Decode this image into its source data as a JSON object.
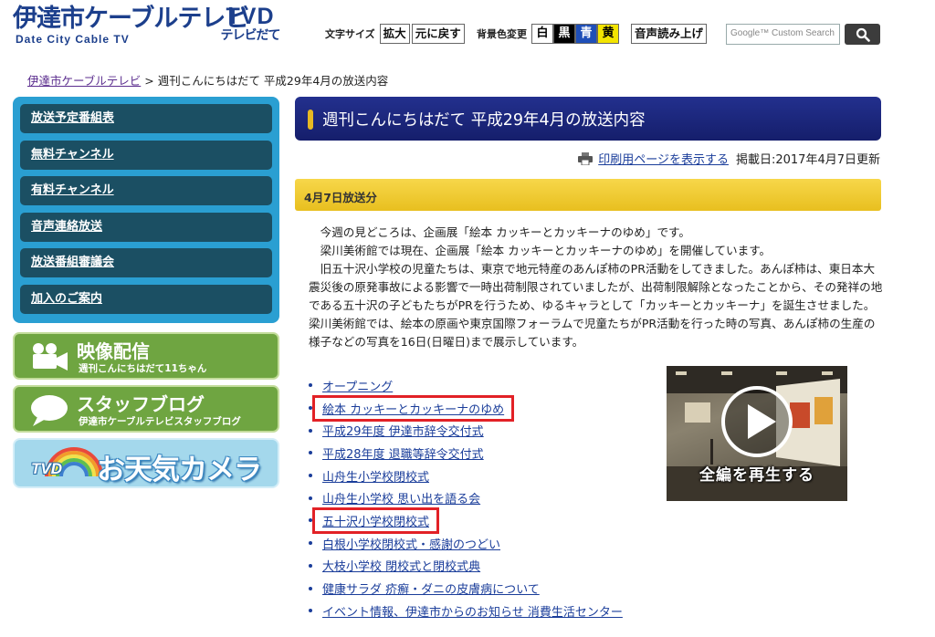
{
  "header": {
    "logo_main": "伊達市ケーブルテレビ",
    "logo_sub": "Date City Cable TV",
    "tvd_big": "TVD",
    "tvd_small": "テレビだて",
    "font_size_label": "文字サイズ",
    "enlarge_btn": "拡大",
    "reset_btn": "元に戻す",
    "bg_color_label": "背景色変更",
    "bg_white": "白",
    "bg_black": "黒",
    "bg_blue": "青",
    "bg_yellow": "黄",
    "read_aloud_btn": "音声読み上げ",
    "search_placeholder": "Google™ Custom Search",
    "search_icon": "magnifier-icon"
  },
  "breadcrumb": {
    "home": "伊達市ケーブルテレビ",
    "separator": " > ",
    "current": "週刊こんにちはだて 平成29年4月の放送内容"
  },
  "sidebar": {
    "items": [
      {
        "label": "放送予定番組表"
      },
      {
        "label": "無料チャンネル"
      },
      {
        "label": "有料チャンネル"
      },
      {
        "label": "音声連絡放送"
      },
      {
        "label": "放送番組審議会"
      },
      {
        "label": "加入のご案内"
      }
    ],
    "video_banner": {
      "title": "映像配信",
      "sub": "週刊こんにちはだて11ちゃん",
      "icon": "video-camera-icon"
    },
    "blog_banner": {
      "title": "スタッフブログ",
      "sub": "伊達市ケーブルテレビスタッフブログ",
      "icon": "speech-bubble-icon"
    },
    "weather_banner": {
      "tvd": "TVD",
      "title": "お天気カメラ",
      "icon": "rainbow-icon"
    }
  },
  "main": {
    "title": "週刊こんにちはだて 平成29年4月の放送内容",
    "print_link": "印刷用ページを表示する",
    "posted_date": "掲載日:2017年4月7日更新",
    "section_title": "4月7日放送分",
    "paragraphs": [
      "今週の見どころは、企画展「絵本 カッキーとカッキーナのゆめ」です。",
      "梁川美術館では現在、企画展「絵本 カッキーとカッキーナのゆめ」を開催しています。",
      "旧五十沢小学校の児童たちは、東京で地元特産のあんぽ柿のPR活動をしてきました。あんぽ柿は、東日本大震災後の原発事故による影響で一時出荷制限されていましたが、出荷制限解除となったことから、その発祥の地である五十沢の子どもたちがPRを行うため、ゆるキャラとして「カッキーとカッキーナ」を誕生させました。梁川美術館では、絵本の原画や東京国際フォーラムで児童たちがPR活動を行った時の写真、あんぽ柿の生産の様子などの写真を16日(日曜日)まで展示しています。"
    ],
    "links": [
      {
        "label": "オープニング",
        "highlighted": false
      },
      {
        "label": "絵本 カッキーとカッキーナのゆめ",
        "highlighted": true
      },
      {
        "label": "平成29年度 伊達市辞令交付式",
        "highlighted": false
      },
      {
        "label": "平成28年度 退職等辞令交付式",
        "highlighted": false
      },
      {
        "label": "山舟生小学校閉校式",
        "highlighted": false
      },
      {
        "label": "山舟生小学校 思い出を語る会",
        "highlighted": false
      },
      {
        "label": "五十沢小学校閉校式",
        "highlighted": true
      },
      {
        "label": "白根小学校閉校式・感謝のつどい",
        "highlighted": false
      },
      {
        "label": "大枝小学校 閉校式と閉校式典",
        "highlighted": false
      },
      {
        "label": "健康サラダ 疥癬・ダニの皮膚病について",
        "highlighted": false
      },
      {
        "label": "イベント情報、伊達市からのお知らせ 消費生活センター",
        "highlighted": false
      }
    ],
    "video": {
      "play_label": "全編を再生する",
      "icon": "play-icon"
    }
  },
  "colors": {
    "brand_blue": "#1c3f8c",
    "sidebar_bg": "#2a9fd2",
    "sidebar_item": "#1b4f63",
    "heading_bg": "#1b257a",
    "section_gold": "#f0cb35",
    "banner_green": "#6fa541",
    "link": "#1a3d9a",
    "highlight_red": "#e22126"
  }
}
